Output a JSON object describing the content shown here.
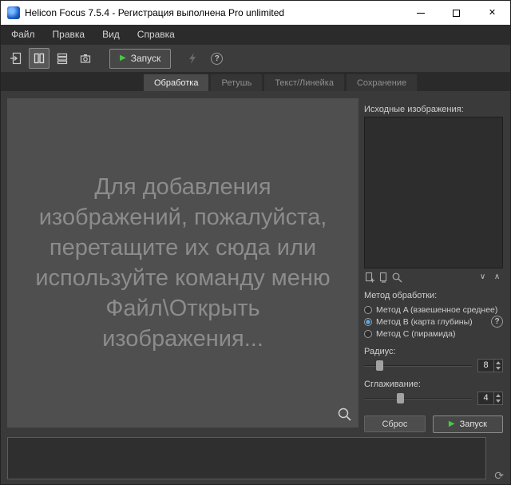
{
  "window": {
    "title": "Helicon Focus 7.5.4 - Регистрация выполнена Pro unlimited"
  },
  "menu": {
    "items": [
      "Файл",
      "Правка",
      "Вид",
      "Справка"
    ]
  },
  "toolbar": {
    "run_label": "Запуск"
  },
  "tabs": [
    {
      "label": "Обработка"
    },
    {
      "label": "Ретушь"
    },
    {
      "label": "Текст/Линейка"
    },
    {
      "label": "Сохранение"
    }
  ],
  "dropzone": {
    "lines": [
      "Для добавления",
      "изображений, пожалуйста,",
      "перетащите их сюда или",
      "используйте команду меню",
      "Файл\\Открыть",
      "изображения..."
    ]
  },
  "source_panel": {
    "title": "Исходные изображения:"
  },
  "method": {
    "title": "Метод обработки:",
    "options": [
      {
        "label": "Метод A (взвешенное среднее)"
      },
      {
        "label": "Метод B (карта глубины)"
      },
      {
        "label": "Метод C (пирамида)"
      }
    ],
    "selected_index": 1
  },
  "sliders": {
    "radius": {
      "label": "Радиус:",
      "value": "8"
    },
    "smoothing": {
      "label": "Сглаживание:",
      "value": "4"
    }
  },
  "actions": {
    "reset_label": "Сброс",
    "run_label": "Запуск"
  },
  "icons": {
    "close": "✕",
    "help": "?",
    "play": "▶",
    "chevron_down": "∨",
    "chevron_up": "∧",
    "refresh": "⟳"
  },
  "colors": {
    "accent_green": "#44c944",
    "titlebar_bg": "#ffffff",
    "panel_bg": "#3a3a3a",
    "dropzone_bg": "#4f4f4f"
  }
}
